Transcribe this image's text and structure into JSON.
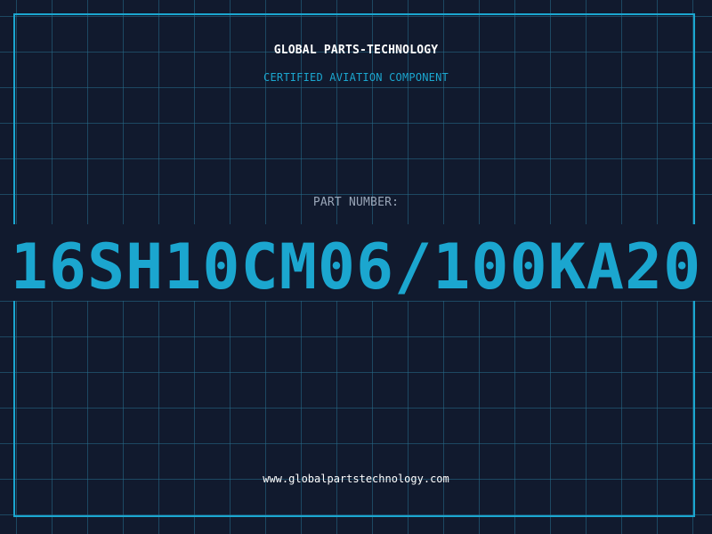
{
  "header": {
    "company": "GLOBAL PARTS-TECHNOLOGY",
    "tagline": "CERTIFIED AVIATION COMPONENT"
  },
  "part": {
    "label": "PART NUMBER:",
    "number": "16SH10CM06/100KA20"
  },
  "footer": {
    "website": "www.globalpartstechnology.com"
  },
  "colors": {
    "background": "#111a2e",
    "accent": "#1ba6cf",
    "grid": "#266e8c",
    "label": "#9aa6b8",
    "text": "#ffffff"
  }
}
